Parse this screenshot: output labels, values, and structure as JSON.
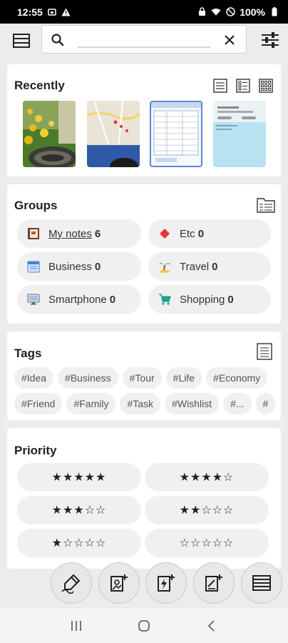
{
  "status_bar": {
    "time": "12:55",
    "battery": "100%"
  },
  "search": {
    "value": "",
    "placeholder": ""
  },
  "recently": {
    "title": "Recently",
    "thumbnails": [
      {
        "name": "thumb-flowers-photo"
      },
      {
        "name": "thumb-map"
      },
      {
        "name": "thumb-table-screenshot"
      },
      {
        "name": "thumb-note-screenshot"
      }
    ]
  },
  "groups": {
    "title": "Groups",
    "items": [
      {
        "label": "My notes",
        "count": "6",
        "icon": "notebook-icon"
      },
      {
        "label": "Etc",
        "count": "0",
        "icon": "diamond-icon"
      },
      {
        "label": "Business",
        "count": "0",
        "icon": "calendar-icon"
      },
      {
        "label": "Travel",
        "count": "0",
        "icon": "palm-tree-icon"
      },
      {
        "label": "Smartphone",
        "count": "0",
        "icon": "monitor-icon"
      },
      {
        "label": "Shopping",
        "count": "0",
        "icon": "cart-icon"
      }
    ]
  },
  "tags": {
    "title": "Tags",
    "row1": [
      "#Idea",
      "#Business",
      "#Tour",
      "#Life",
      "#Economy"
    ],
    "row2": [
      "#Friend",
      "#Family",
      "#Task",
      "#Wishlist",
      "#...",
      "#"
    ]
  },
  "priority": {
    "title": "Priority",
    "items": [
      "★★★★★",
      "★★★★☆",
      "★★★☆☆",
      "★★☆☆☆",
      "★☆☆☆☆",
      "☆☆☆☆☆"
    ]
  },
  "colors": {
    "accent": "#2a5fb0",
    "diamond": "#e53935",
    "cart": "#1aa394",
    "background": "#ececec"
  }
}
